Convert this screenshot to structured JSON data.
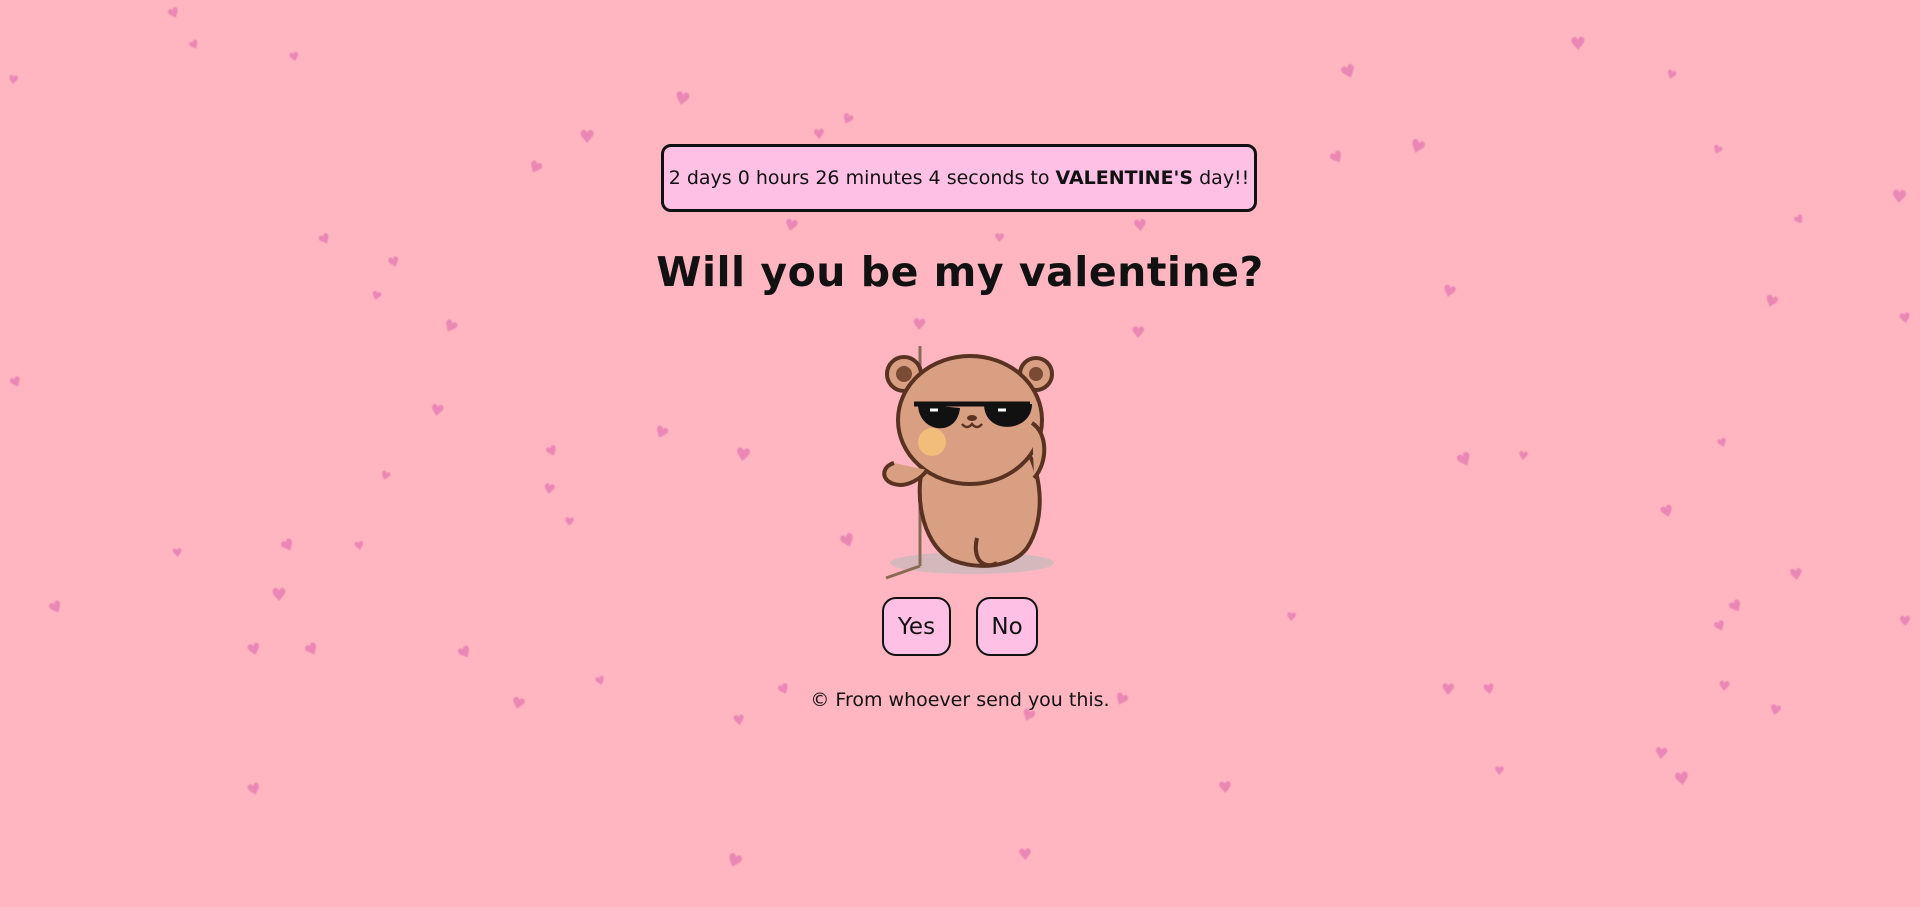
{
  "countdown": {
    "days": "2",
    "days_unit": "days",
    "hours": "0",
    "hours_unit": "hours",
    "minutes": "26",
    "minutes_unit": "minutes",
    "seconds": "4",
    "seconds_unit": "seconds",
    "to_text": "to",
    "holiday": "VALENTINE'S",
    "suffix": "day!!"
  },
  "question": "Will you be my valentine?",
  "bear": {
    "icon": "bear-with-sunglasses-icon"
  },
  "buttons": {
    "yes_label": "Yes",
    "no_label": "No"
  },
  "footer": "© From whoever send you this.",
  "colors": {
    "background": "#ffb6c1",
    "panel": "#ffc0e6",
    "heart": "#e77fb3",
    "border": "#111111"
  },
  "background_icon": "heart-icon"
}
